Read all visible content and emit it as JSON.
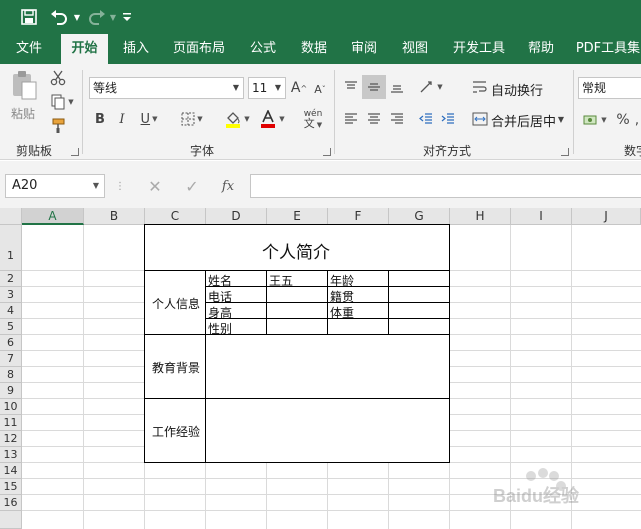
{
  "quick_access": {
    "save_icon": "save-icon",
    "undo_icon": "undo-icon",
    "redo_icon": "redo-icon",
    "customize_icon": "customize-qat-icon"
  },
  "colors": {
    "accent": "#217346",
    "ribbon_bg": "#f3f3f3",
    "grid": "#dadada",
    "header_bg": "#e6e6e6"
  },
  "tabs": [
    {
      "label": "文件"
    },
    {
      "label": "开始"
    },
    {
      "label": "插入"
    },
    {
      "label": "页面布局"
    },
    {
      "label": "公式"
    },
    {
      "label": "数据"
    },
    {
      "label": "审阅"
    },
    {
      "label": "视图"
    },
    {
      "label": "开发工具"
    },
    {
      "label": "帮助"
    },
    {
      "label": "PDF工具集"
    }
  ],
  "ribbon": {
    "clipboard": {
      "paste_label": "粘贴",
      "group_label": "剪贴板"
    },
    "font": {
      "font_name": "等线",
      "font_size": "11",
      "bold": "B",
      "italic": "I",
      "underline": "U",
      "grow": "A",
      "shrink": "A",
      "phonetic": "wén",
      "group_label": "字体"
    },
    "alignment": {
      "wrap_text": "自动换行",
      "merge_center": "合并后居中",
      "group_label": "对齐方式"
    },
    "number": {
      "format": "常规",
      "percent": "%",
      "group_label": "数字"
    }
  },
  "formula_bar": {
    "name_box": "A20",
    "fx": "fx",
    "formula": ""
  },
  "sheet": {
    "columns": [
      "A",
      "B",
      "C",
      "D",
      "E",
      "F",
      "G",
      "H",
      "I",
      "J"
    ],
    "rows": [
      "1",
      "2",
      "3",
      "4",
      "5",
      "6",
      "7",
      "8",
      "9",
      "10",
      "11",
      "12",
      "13",
      "14",
      "15",
      "16"
    ],
    "title": "个人简介",
    "section_personal": "个人信息",
    "section_education": "教育背景",
    "section_work": "工作经验",
    "field_name": "姓名",
    "field_name_value": "王五",
    "field_age": "年龄",
    "field_phone": "电话",
    "field_origin": "籍贯",
    "field_height": "身高",
    "field_weight": "体重",
    "field_gender": "性别"
  },
  "watermark": {
    "text": "Baidu经验"
  }
}
